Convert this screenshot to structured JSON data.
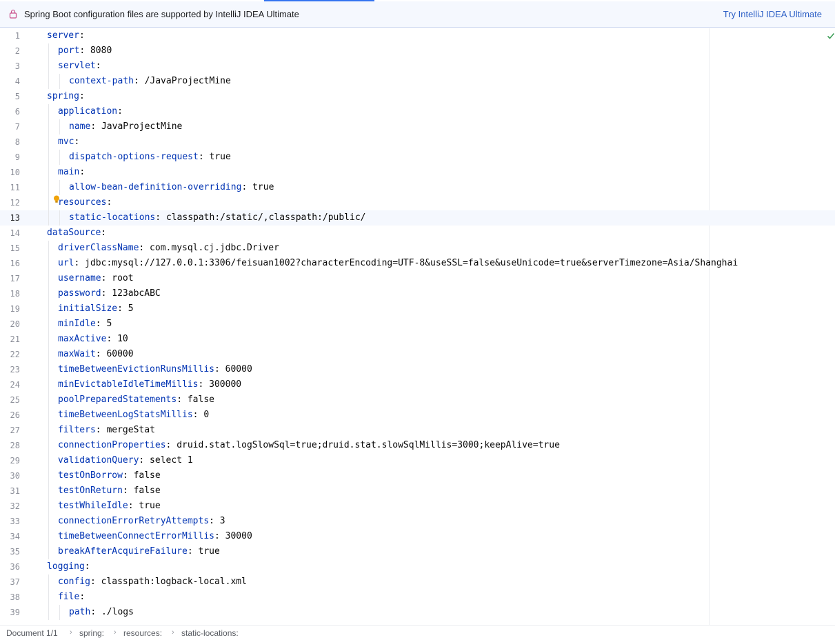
{
  "banner": {
    "message": "Spring Boot configuration files are supported by IntelliJ IDEA Ultimate",
    "action_label": "Try IntelliJ IDEA Ultimate"
  },
  "editor": {
    "current_line": 13,
    "lines": [
      {
        "n": "1",
        "indent": 0,
        "key": "server",
        "sep": ":",
        "val": ""
      },
      {
        "n": "2",
        "indent": 1,
        "key": "port",
        "sep": ":",
        "val": " 8080"
      },
      {
        "n": "3",
        "indent": 1,
        "key": "servlet",
        "sep": ":",
        "val": ""
      },
      {
        "n": "4",
        "indent": 2,
        "key": "context-path",
        "sep": ":",
        "val": " /JavaProjectMine"
      },
      {
        "n": "5",
        "indent": 0,
        "key": "spring",
        "sep": ":",
        "val": ""
      },
      {
        "n": "6",
        "indent": 1,
        "key": "application",
        "sep": ":",
        "val": ""
      },
      {
        "n": "7",
        "indent": 2,
        "key": "name",
        "sep": ":",
        "val": " JavaProjectMine"
      },
      {
        "n": "8",
        "indent": 1,
        "key": "mvc",
        "sep": ":",
        "val": ""
      },
      {
        "n": "9",
        "indent": 2,
        "key": "dispatch-options-request",
        "sep": ":",
        "val": " true"
      },
      {
        "n": "10",
        "indent": 1,
        "key": "main",
        "sep": ":",
        "val": ""
      },
      {
        "n": "11",
        "indent": 2,
        "key": "allow-bean-definition-overriding",
        "sep": ":",
        "val": " true"
      },
      {
        "n": "12",
        "indent": 1,
        "key": "resources",
        "sep": ":",
        "val": ""
      },
      {
        "n": "13",
        "indent": 2,
        "key": "static-locations",
        "sep": ":",
        "val": " classpath:/static/,classpath:/public/"
      },
      {
        "n": "14",
        "indent": 0,
        "key": "dataSource",
        "sep": ":",
        "val": ""
      },
      {
        "n": "15",
        "indent": 1,
        "key": "driverClassName",
        "sep": ":",
        "val": " com.mysql.cj.jdbc.Driver"
      },
      {
        "n": "16",
        "indent": 1,
        "key": "url",
        "sep": ":",
        "val": " jdbc:mysql://127.0.0.1:3306/feisuan1002?characterEncoding=UTF-8&useSSL=false&useUnicode=true&serverTimezone=Asia/Shanghai"
      },
      {
        "n": "17",
        "indent": 1,
        "key": "username",
        "sep": ":",
        "val": " root"
      },
      {
        "n": "18",
        "indent": 1,
        "key": "password",
        "sep": ":",
        "val": " 123abcABC"
      },
      {
        "n": "19",
        "indent": 1,
        "key": "initialSize",
        "sep": ":",
        "val": " 5"
      },
      {
        "n": "20",
        "indent": 1,
        "key": "minIdle",
        "sep": ":",
        "val": " 5"
      },
      {
        "n": "21",
        "indent": 1,
        "key": "maxActive",
        "sep": ":",
        "val": " 10"
      },
      {
        "n": "22",
        "indent": 1,
        "key": "maxWait",
        "sep": ":",
        "val": " 60000"
      },
      {
        "n": "23",
        "indent": 1,
        "key": "timeBetweenEvictionRunsMillis",
        "sep": ":",
        "val": " 60000"
      },
      {
        "n": "24",
        "indent": 1,
        "key": "minEvictableIdleTimeMillis",
        "sep": ":",
        "val": " 300000"
      },
      {
        "n": "25",
        "indent": 1,
        "key": "poolPreparedStatements",
        "sep": ":",
        "val": " false"
      },
      {
        "n": "26",
        "indent": 1,
        "key": "timeBetweenLogStatsMillis",
        "sep": ":",
        "val": " 0"
      },
      {
        "n": "27",
        "indent": 1,
        "key": "filters",
        "sep": ":",
        "val": " mergeStat"
      },
      {
        "n": "28",
        "indent": 1,
        "key": "connectionProperties",
        "sep": ":",
        "val": " druid.stat.logSlowSql=true;druid.stat.slowSqlMillis=3000;keepAlive=true"
      },
      {
        "n": "29",
        "indent": 1,
        "key": "validationQuery",
        "sep": ":",
        "val": " select 1"
      },
      {
        "n": "30",
        "indent": 1,
        "key": "testOnBorrow",
        "sep": ":",
        "val": " false"
      },
      {
        "n": "31",
        "indent": 1,
        "key": "testOnReturn",
        "sep": ":",
        "val": " false"
      },
      {
        "n": "32",
        "indent": 1,
        "key": "testWhileIdle",
        "sep": ":",
        "val": " true"
      },
      {
        "n": "33",
        "indent": 1,
        "key": "connectionErrorRetryAttempts",
        "sep": ":",
        "val": " 3"
      },
      {
        "n": "34",
        "indent": 1,
        "key": "timeBetweenConnectErrorMillis",
        "sep": ":",
        "val": " 30000"
      },
      {
        "n": "35",
        "indent": 1,
        "key": "breakAfterAcquireFailure",
        "sep": ":",
        "val": " true"
      },
      {
        "n": "36",
        "indent": 0,
        "key": "logging",
        "sep": ":",
        "val": ""
      },
      {
        "n": "37",
        "indent": 1,
        "key": "config",
        "sep": ":",
        "val": " classpath:logback-local.xml"
      },
      {
        "n": "38",
        "indent": 1,
        "key": "file",
        "sep": ":",
        "val": ""
      },
      {
        "n": "39",
        "indent": 2,
        "key": "path",
        "sep": ":",
        "val": " ./logs"
      }
    ]
  },
  "status_bar": {
    "document": "Document 1/1",
    "breadcrumbs": [
      "spring:",
      "resources:",
      "static-locations:"
    ]
  },
  "colors": {
    "key": "#0033b3",
    "accent": "#3574f0",
    "current_line_bg": "#f5f8fe"
  },
  "icons": {
    "banner": "lock-icon",
    "gutter": "intention-bulb-icon",
    "inspection": "checkmark-icon"
  }
}
